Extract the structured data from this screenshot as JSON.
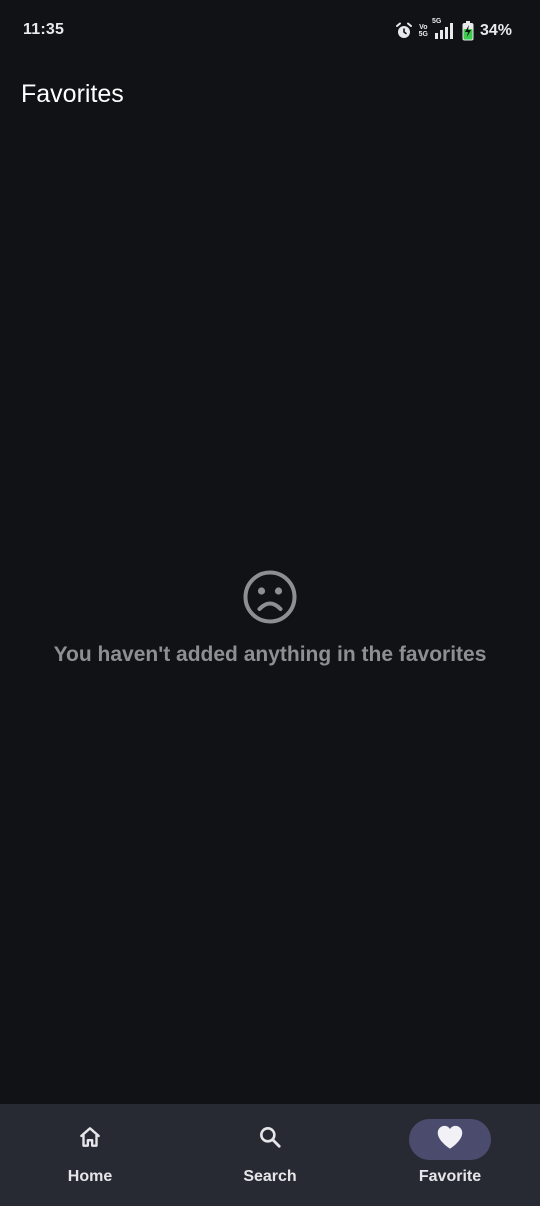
{
  "status_bar": {
    "time": "11:35",
    "battery_percent": "34%",
    "network_labels": [
      "Vo",
      "5G",
      "5G"
    ],
    "icons": [
      "alarm-icon",
      "volte-icon",
      "signal-icon",
      "battery-charging-icon"
    ]
  },
  "header": {
    "title": "Favorites"
  },
  "empty_state": {
    "icon": "sad-face-icon",
    "message": "You haven't added anything in the favorites"
  },
  "bottom_nav": {
    "items": [
      {
        "label": "Home",
        "icon": "home-icon",
        "active": false
      },
      {
        "label": "Search",
        "icon": "search-icon",
        "active": false
      },
      {
        "label": "Favorite",
        "icon": "heart-icon",
        "active": true
      }
    ]
  },
  "colors": {
    "background": "#111216",
    "nav_background": "#282a33",
    "active_pill": "#4b4c6d",
    "empty_text": "#8e8f94",
    "battery_green": "#3ccb4a"
  }
}
